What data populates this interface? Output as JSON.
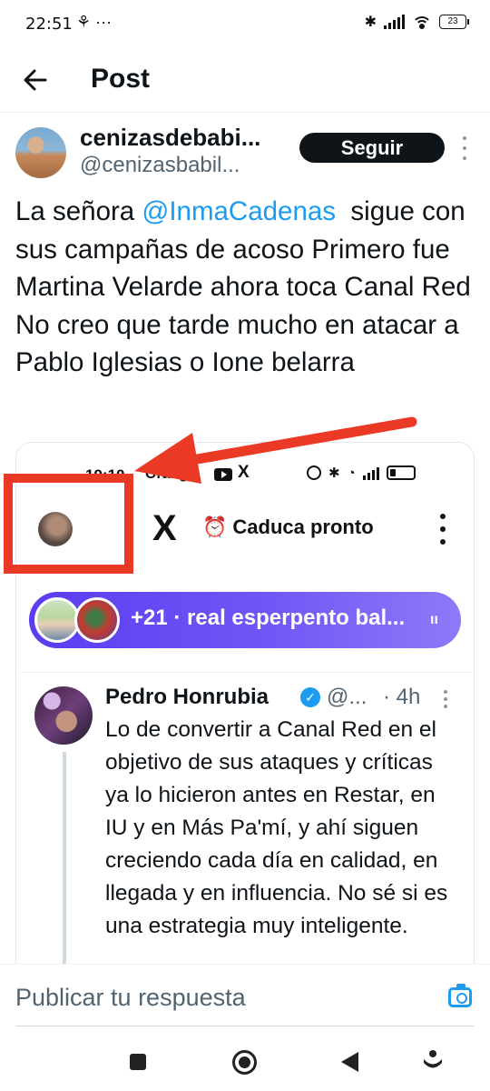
{
  "status_bar": {
    "time": "22:51",
    "left_icons": "⚘ ···",
    "battery": "23"
  },
  "header": {
    "title": "Post"
  },
  "tweet": {
    "author_name": "cenizasdebabi...",
    "author_handle": "@cenizasbabil...",
    "follow_label": "Seguir",
    "text_before_mention": "La señora ",
    "mention": "@InmaCadenas",
    "text_after_mention": "  sigue con sus campañas de acoso Primero fue Martina Velarde ahora toca Canal Red No creo que tarde mucho en atacar a Pablo Iglesias o Ione belarra"
  },
  "embedded_screenshot": {
    "status_time": "19:10",
    "status_carrier": "Orange",
    "x_small": "X",
    "x_logo": "X",
    "expire_clock": "⏰",
    "expire_label": "Caduca pronto",
    "community_text": "+21 · real esperpento bal...",
    "community_icon": "ıı",
    "quoted": {
      "name": "Pedro Honrubia",
      "handle": "@...",
      "time": "· 4h",
      "text": "Lo de convertir a Canal Red en el objetivo de sus ataques y críticas ya lo hicieron antes en Restar, en IU y en Más Pa'mí, y ahí siguen creciendo cada día en calidad, en llegada y en influencia. No sé si es una estrategia muy inteligente."
    }
  },
  "reply": {
    "placeholder": "Publicar tu respuesta"
  },
  "colors": {
    "accent": "#1d9bf0",
    "annotation_red": "#ea3a26",
    "community_gradient_start": "#5b3cf0"
  }
}
